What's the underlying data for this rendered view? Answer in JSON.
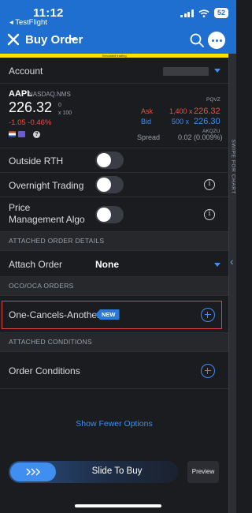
{
  "status_bar": {
    "time": "11:12",
    "back_app": "◂ TestFlight",
    "battery": "52"
  },
  "nav": {
    "title": "Buy Order",
    "simulated_banner": "Simulated trading"
  },
  "rail": {
    "label": "SWIPE FOR CHART"
  },
  "account": {
    "label": "Account"
  },
  "quote": {
    "symbol": "AAPL",
    "exchange": "NASDAQ.NMS",
    "small_zero": "0",
    "price": "226.32",
    "multiplier": "x 100",
    "change": "-1.05  -0.46%",
    "help": "?",
    "ask_exchange": "PQVZ",
    "ask_label": "Ask",
    "ask_size": "1,400 x",
    "ask_price": "226.32",
    "bid_label": "Bid",
    "bid_size": "500 x",
    "bid_price": "226.30",
    "bid_exchange": "AKQZU",
    "spread_label": "Spread",
    "spread_value": "0.02 (0.009%)"
  },
  "toggles": [
    {
      "label": "Outside RTH",
      "on": false,
      "info": false
    },
    {
      "label": "Overnight Trading",
      "on": false,
      "info": true
    },
    {
      "label": "Price Management Algo",
      "on": false,
      "info": true
    }
  ],
  "sections": {
    "attached_order_details": "ATTACHED ORDER DETAILS",
    "oco": "OCO/OCA ORDERS",
    "attached_conditions": "ATTACHED CONDITIONS"
  },
  "attach_order": {
    "label": "Attach Order",
    "value": "None"
  },
  "oca": {
    "label": "One-Cancels-Another",
    "badge": "NEW"
  },
  "conditions": {
    "label": "Order Conditions"
  },
  "show_fewer": "Show Fewer Options",
  "bottom": {
    "slide_label": "Slide To Buy",
    "preview_label": "Preview"
  },
  "colors": {
    "accent": "#3f8ef0",
    "header": "#1f6fd1",
    "ask": "#ef4b4b",
    "background": "#1b1c1f",
    "highlight": "#e04545"
  }
}
